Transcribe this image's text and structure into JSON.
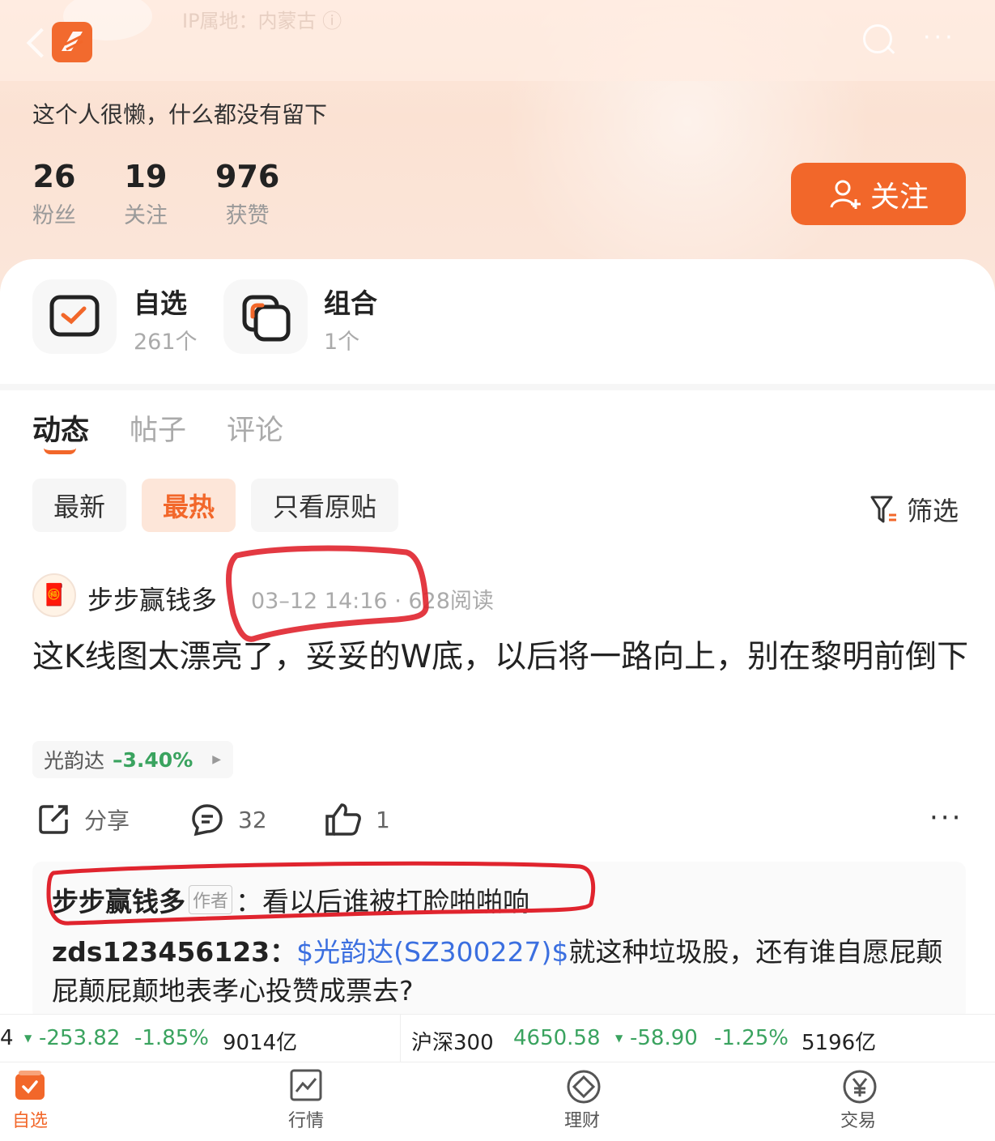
{
  "header": {
    "ip_location": "IP属地：内蒙古 ⓘ",
    "bio": "这个人很懒，什么都没有留下",
    "stats": [
      {
        "num": "26",
        "label": "粉丝"
      },
      {
        "num": "19",
        "label": "关注"
      },
      {
        "num": "976",
        "label": "获赞"
      }
    ],
    "follow_label": "关注"
  },
  "tiles": [
    {
      "title": "自选",
      "sub": "261个"
    },
    {
      "title": "组合",
      "sub": "1个"
    }
  ],
  "tabs": [
    "动态",
    "帖子",
    "评论"
  ],
  "chips": [
    "最新",
    "最热",
    "只看原贴"
  ],
  "filter_label": "筛选",
  "post": {
    "author": "步步赢钱多",
    "meta": "03–12 14:16 · 628阅读",
    "text": "这K线图太漂亮了，妥妥的W底，以后将一路向上，别在黎明前倒下",
    "stock_name": "光韵达",
    "stock_change": "–3.40%",
    "share_label": "分享",
    "comment_count": "32",
    "like_count": "1"
  },
  "comments": {
    "c1_name": "步步赢钱多",
    "c1_badge": "作者",
    "c1_text": "：看以后谁被打脸啪啪响",
    "c2_name": "zds123456123：",
    "c2_link": "$光韵达(SZ300227)$",
    "c2_text": "就这种垃圾股，还有谁自愿屁颠屁颠屁颠地表孝心投赞成票去?"
  },
  "ticker": {
    "left_lead": "4",
    "left_change": "-253.82",
    "left_pct": "-1.85%",
    "left_volume": "9014亿",
    "right_name": "沪深300",
    "right_value": "4650.58",
    "right_change": "-58.90",
    "right_pct": "-1.25%",
    "right_volume": "5196亿"
  },
  "tabbar": [
    "自选",
    "行情",
    "理财",
    "交易"
  ],
  "colors": {
    "accent": "#f2672a",
    "down": "#3aa35f",
    "link": "#3b6fe0",
    "annotation": "#e0242e"
  }
}
